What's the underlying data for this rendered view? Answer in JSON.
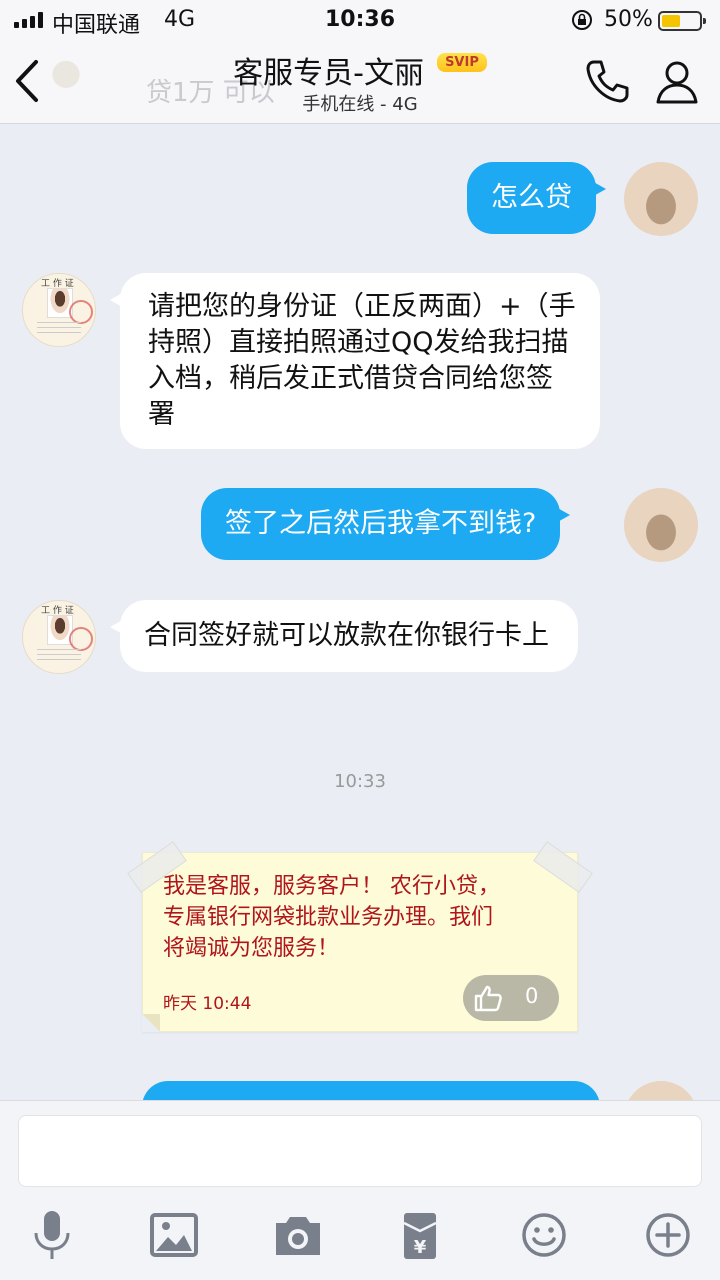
{
  "status_bar": {
    "carrier": "中国联通",
    "network": "4G",
    "time": "10:36",
    "battery_percent": "50%",
    "battery_level": 0.5,
    "battery_color": "#f5c400"
  },
  "header": {
    "title": "客服专员-文丽",
    "badge": "SVIP",
    "subtitle": "手机在线 - 4G",
    "background_snippet": "贷1万  可以",
    "icons": [
      "back-arrow-icon",
      "phone-icon",
      "profile-icon"
    ]
  },
  "messages": [
    {
      "side": "out",
      "text": "怎么贷"
    },
    {
      "side": "in",
      "text": "请把您的身份证（正反两面）+（手持照）直接拍照通过QQ发给我扫描入档，稍后发正式借贷合同给您签署"
    },
    {
      "side": "out",
      "text": "签了之后然后我拿不到钱?"
    },
    {
      "side": "in",
      "text": "合同签好就可以放款在你银行卡上"
    }
  ],
  "time_separator": "10:33",
  "note_card": {
    "text": "我是客服，服务客户！ 农行小贷，专属银行网袋批款业务办理。我们将竭诚为您服务！",
    "timestamp": "昨天 10:44",
    "like_count": "0"
  },
  "agent_avatar_header": "工 作 证",
  "input": {
    "value": "",
    "placeholder": ""
  },
  "toolbar": [
    "microphone-icon",
    "image-icon",
    "camera-icon",
    "red-packet-icon",
    "emoji-icon",
    "plus-icon"
  ],
  "colors": {
    "outgoing_bubble": "#1ea9f3",
    "incoming_bubble": "#ffffff",
    "chat_background": "#eaedf4",
    "note_text": "#b0151c",
    "badge": "#ffc21c"
  }
}
